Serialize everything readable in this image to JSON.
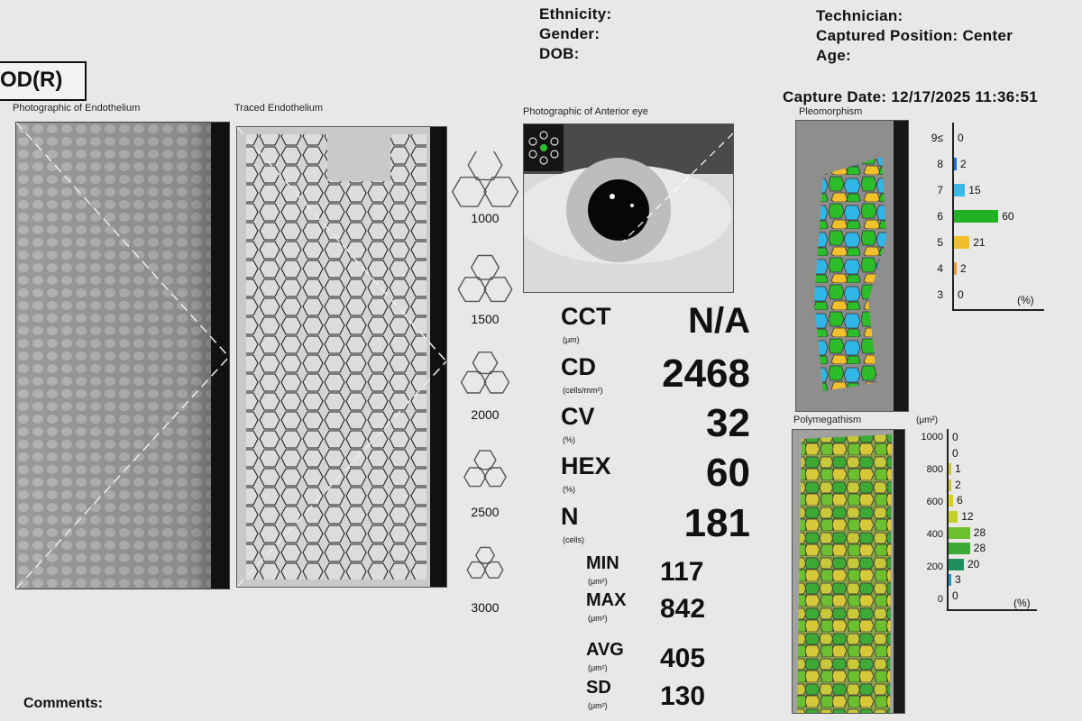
{
  "patient": {
    "ethnicity_label": "Ethnicity:",
    "gender_label": "Gender:",
    "dob_label": "DOB:",
    "technician_label": "Technician:",
    "captured_position": "Captured Position: Center",
    "age_label": "Age:",
    "capture_date": "Capture Date: 12/17/2025 11:36:51"
  },
  "eye_label": "OD(R)",
  "captions": {
    "photo_endothelium": "Photographic of Endothelium",
    "traced_endothelium": "Traced Endothelium",
    "anterior_eye": "Photographic of Anterior eye",
    "pleomorphism": "Pleomorphism",
    "polymegathism": "Polymegathism"
  },
  "density_scale": [
    "1000",
    "1500",
    "2000",
    "2500",
    "3000"
  ],
  "metrics": [
    {
      "label": "CCT",
      "unit": "(μm)",
      "value": "N/A"
    },
    {
      "label": "CD",
      "unit": "(cells/mm²)",
      "value": "2468"
    },
    {
      "label": "CV",
      "unit": "(%)",
      "value": "32"
    },
    {
      "label": "HEX",
      "unit": "(%)",
      "value": "60"
    },
    {
      "label": "N",
      "unit": "(cells)",
      "value": "181"
    }
  ],
  "sub_metrics": [
    {
      "label": "MIN",
      "unit": "(μm²)",
      "value": "117"
    },
    {
      "label": "MAX",
      "unit": "(μm²)",
      "value": "842"
    },
    {
      "label": "AVG",
      "unit": "(μm²)",
      "value": "405"
    },
    {
      "label": "SD",
      "unit": "(μm²)",
      "value": "130"
    }
  ],
  "chart_data": [
    {
      "type": "bar",
      "title": "Pleomorphism",
      "categories": [
        "9≤",
        "8",
        "7",
        "6",
        "5",
        "4",
        "3"
      ],
      "values": [
        0,
        2,
        15,
        60,
        21,
        2,
        0
      ],
      "colors": [
        "#1c6fd0",
        "#1c6fd0",
        "#3ab8e6",
        "#22b024",
        "#f0c02a",
        "#f09a30",
        "#e06020"
      ],
      "unit_label": "(%)"
    },
    {
      "type": "bar",
      "title": "Polymegathism",
      "axis_unit": "(μm²)",
      "ticks": [
        "1000",
        "800",
        "600",
        "400",
        "200",
        "0"
      ],
      "values": [
        0,
        0,
        1,
        2,
        6,
        12,
        28,
        28,
        20,
        3,
        0
      ],
      "colors": [
        "#c9c93a",
        "#c9c93a",
        "#c9c93a",
        "#c9c93a",
        "#d6d020",
        "#c6cf2a",
        "#6cc030",
        "#3caa35",
        "#1f8f5e",
        "#2a8fc0",
        "#2a8fc0"
      ],
      "unit_label": "(%)"
    }
  ],
  "comments_label": "Comments:"
}
